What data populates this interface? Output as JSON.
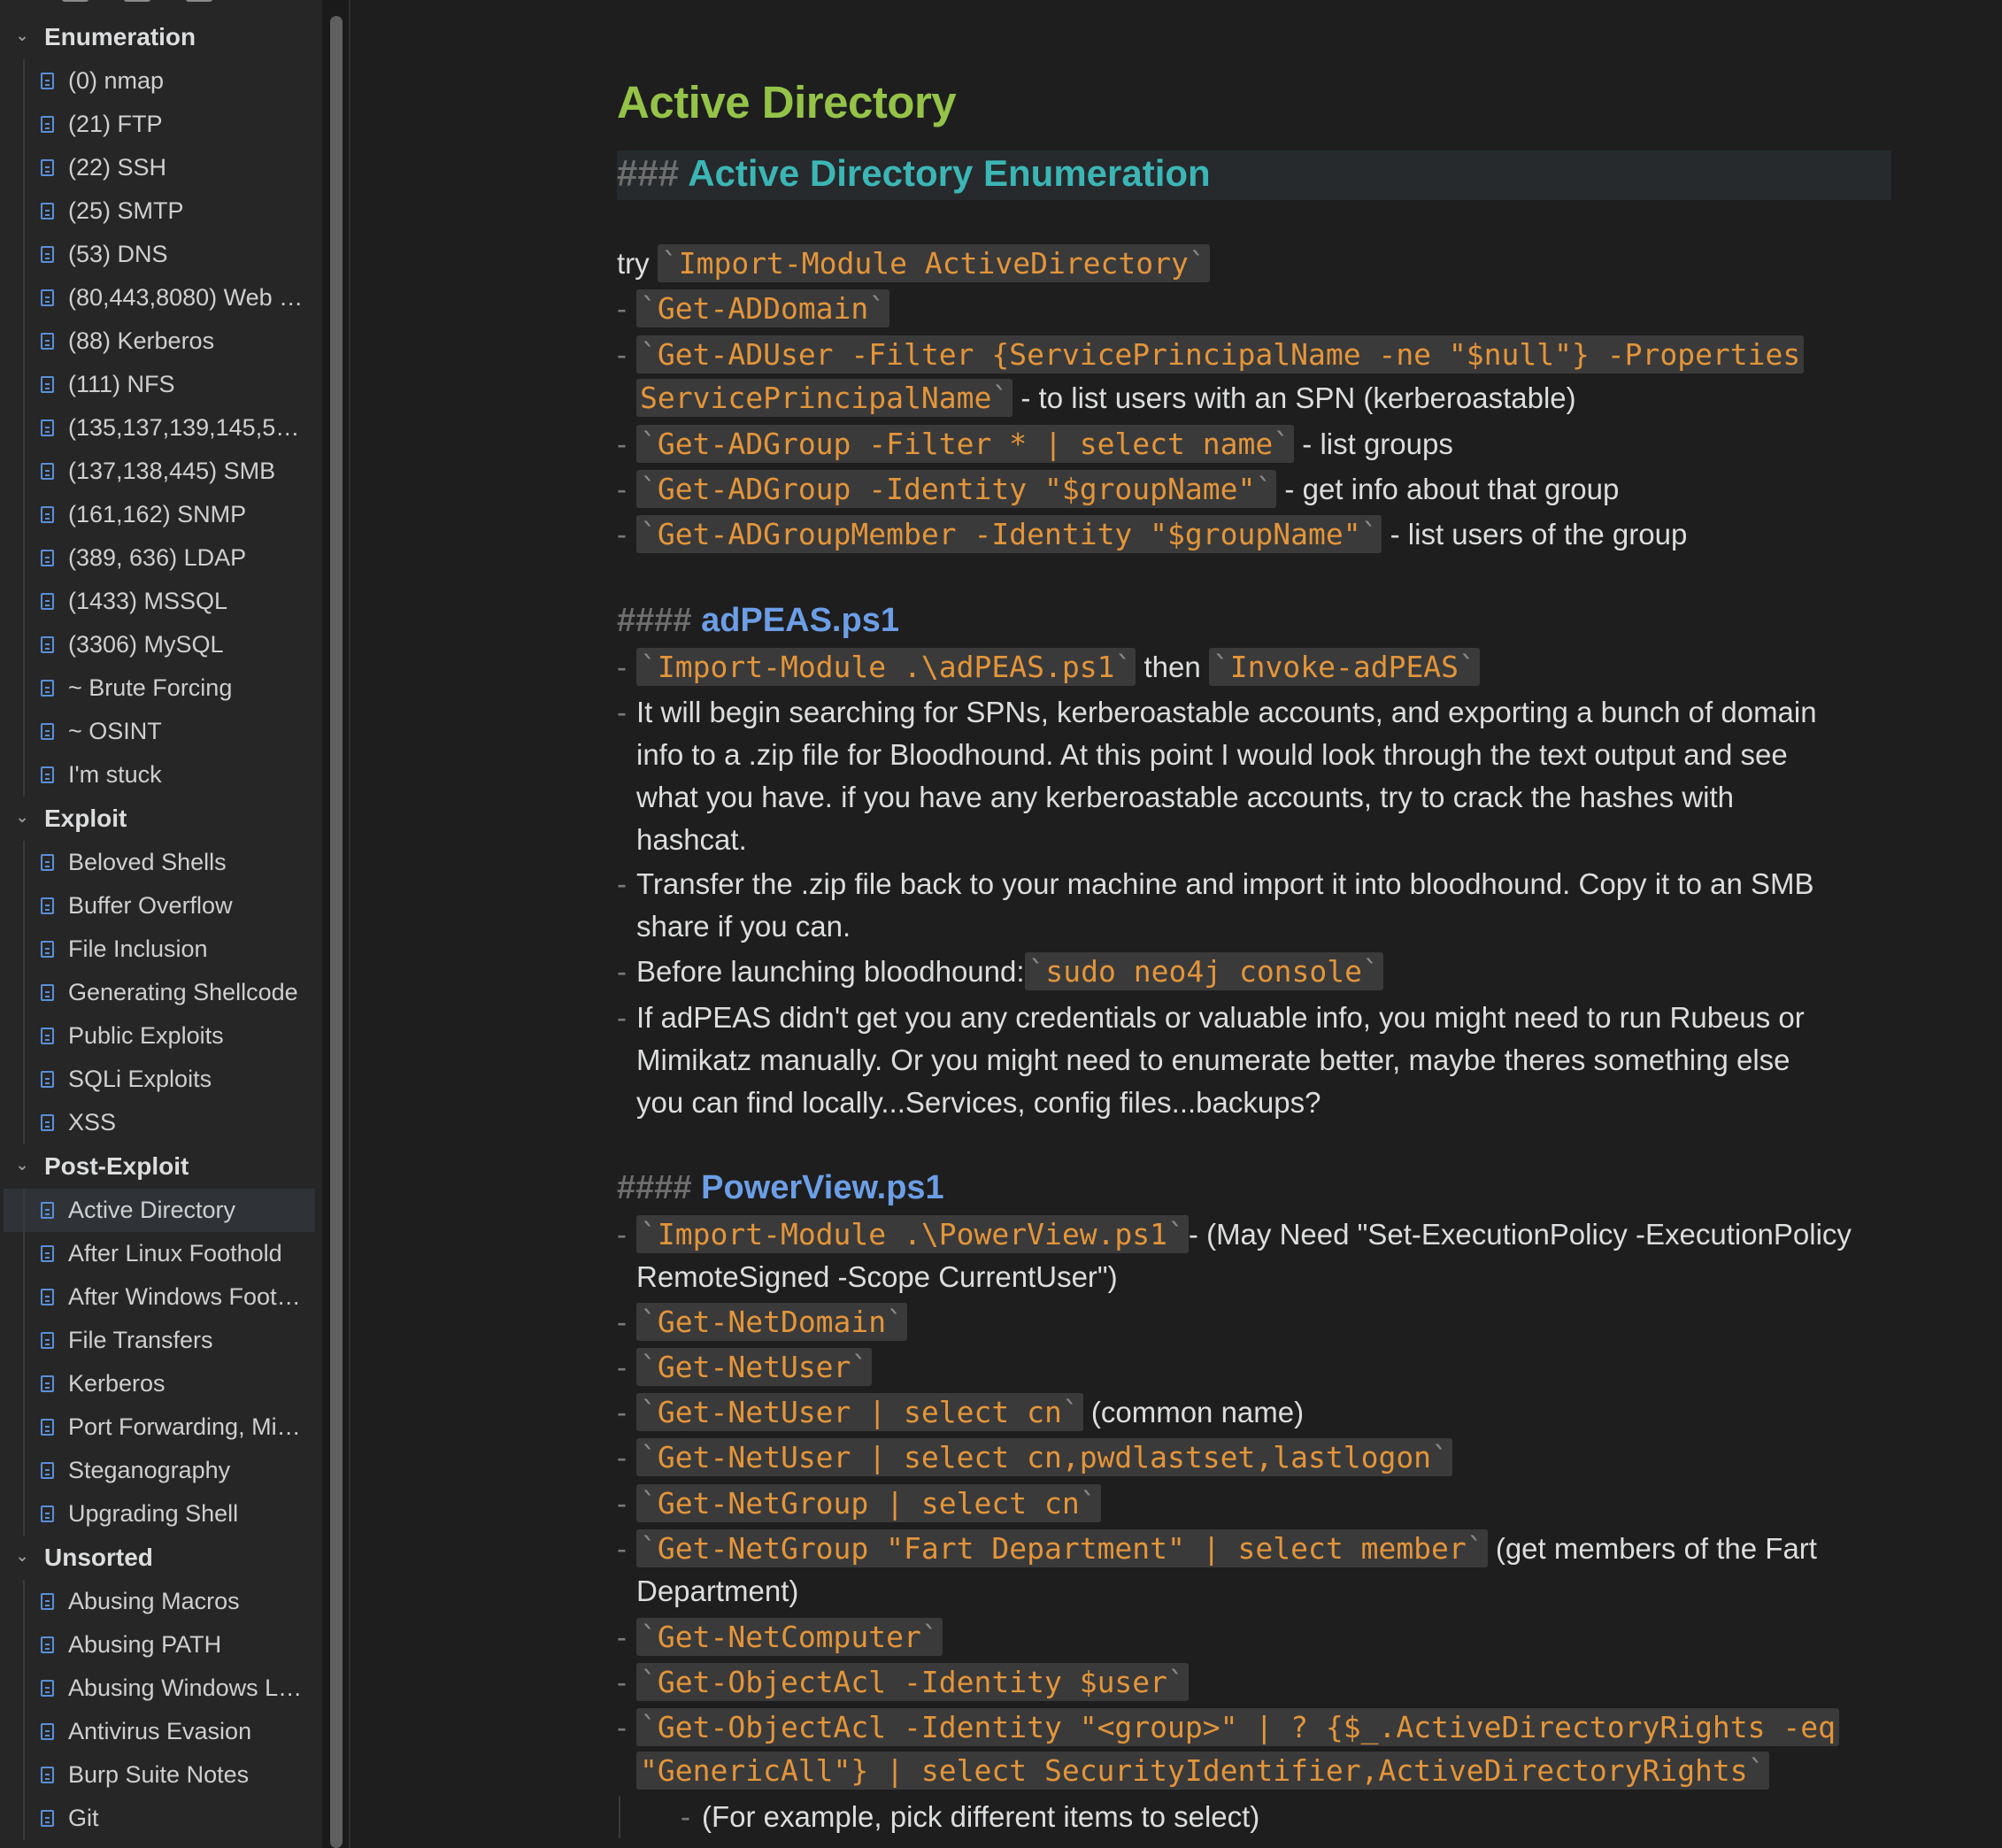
{
  "sidebar": {
    "folders": [
      {
        "label": "Enumeration",
        "items": [
          "(0) nmap",
          "(21) FTP",
          "(22) SSH",
          "(25) SMTP",
          "(53) DNS",
          "(80,443,8080) Web …",
          "(88) Kerberos",
          "(111) NFS",
          "(135,137,139,145,5…",
          "(137,138,445) SMB",
          "(161,162) SNMP",
          "(389, 636) LDAP",
          "(1433) MSSQL",
          "(3306) MySQL",
          "~ Brute Forcing",
          "~ OSINT",
          "I'm stuck"
        ]
      },
      {
        "label": "Exploit",
        "items": [
          "Beloved Shells",
          "Buffer Overflow",
          "File Inclusion",
          "Generating Shellcode",
          "Public Exploits",
          "SQLi Exploits",
          "XSS"
        ]
      },
      {
        "label": "Post-Exploit",
        "items": [
          "Active Directory",
          "After Linux Foothold",
          "After Windows Foot…",
          "File Transfers",
          "Kerberos",
          "Port Forwarding, Mi…",
          "Steganography",
          "Upgrading Shell"
        ]
      },
      {
        "label": "Unsorted",
        "items": [
          "Abusing Macros",
          "Abusing PATH",
          "Abusing Windows L…",
          "Antivirus Evasion",
          "Burp Suite Notes",
          "Git"
        ]
      }
    ],
    "active_item": "Active Directory"
  },
  "doc": {
    "title": "Active Directory",
    "h3_marker": "###",
    "h3": "Active Directory Enumeration",
    "try_text": "try",
    "import_ad": "Import-Module ActiveDirectory",
    "get_addomain": "Get-ADDomain",
    "get_aduser_1": "Get-ADUser -Filter {ServicePrincipalName -ne \"$null\"} -Properties",
    "get_aduser_2": "ServicePrincipalName",
    "get_aduser_desc": " - to list users with an SPN (kerberoastable)",
    "get_adgroup_filter": "Get-ADGroup -Filter * | select name",
    "get_adgroup_filter_desc": " - list groups",
    "get_adgroup_identity": "Get-ADGroup -Identity \"$groupName\"",
    "get_adgroup_identity_desc": " - get info about that group",
    "get_adgroupmember": "Get-ADGroupMember -Identity \"$groupName\"",
    "get_adgroupmember_desc": " - list users of the group",
    "h4_marker": "####",
    "h4_adpeas": "adPEAS.ps1",
    "import_adpeas": "Import-Module .\\adPEAS.ps1",
    "then_text": " then ",
    "invoke_adpeas": "Invoke-adPEAS",
    "adpeas_p1_l1": "It will begin searching for SPNs, kerberoastable accounts, and exporting a bunch of domain",
    "adpeas_p1_l2": "info to a .zip file for Bloodhound.  At this point I would look through the text output and see",
    "adpeas_p1_l3": "what you have.  if you have any kerberoastable accounts, try to crack the hashes with",
    "adpeas_p1_l4": "hashcat.",
    "adpeas_p2_l1": "Transfer the .zip file back to your machine and import it into bloodhound.  Copy it to an SMB",
    "adpeas_p2_l2": "share if you can.",
    "adpeas_p3": "Before launching bloodhound:",
    "neo4j": "sudo neo4j console",
    "adpeas_p4_l1": "If adPEAS didn't get you any credentials or valuable info, you might need to run Rubeus or",
    "adpeas_p4_l2": "Mimikatz manually.  Or you might need to enumerate better, maybe theres something else",
    "adpeas_p4_l3": "you can find locally...Services, config files...backups?",
    "h4_powerview": "PowerView.ps1",
    "import_powerview": "Import-Module .\\PowerView.ps1",
    "powerview_desc_1": "- (May Need \"Set-ExecutionPolicy -ExecutionPolicy",
    "powerview_desc_2": "RemoteSigned -Scope CurrentUser\")",
    "get_netdomain": "Get-NetDomain",
    "get_netuser": "Get-NetUser",
    "get_netuser_cn": "Get-NetUser | select cn",
    "get_netuser_cn_desc": " (common name)",
    "get_netuser_multi": "Get-NetUser | select cn,pwdlastset,lastlogon",
    "get_netgroup_cn": "Get-NetGroup | select cn",
    "get_netgroup_fart": "Get-NetGroup \"Fart Department\" | select member",
    "get_netgroup_fart_desc_1": " (get members of the Fart",
    "get_netgroup_fart_desc_2": "Department)",
    "get_netcomputer": "Get-NetComputer",
    "get_objectacl_user": "Get-ObjectAcl -Identity $user",
    "get_objectacl_group_1": "Get-ObjectAcl -Identity \"<group>\" | ? {$_.ActiveDirectoryRights -eq",
    "get_objectacl_group_2": "\"GenericAll\"} | select SecurityIdentifier,ActiveDirectoryRights",
    "example_note": "(For example, pick different items to select)"
  },
  "colors": {
    "background": "#1e1e1e",
    "sidebar": "#262626",
    "h1": "#94c348",
    "h3": "#3cb5b5",
    "h4": "#6c9ee6",
    "code": "#e3953a",
    "file_icon": "#5a8fd8"
  },
  "icons": {
    "file": "file-text-icon",
    "folder_toggle": "chevron-down-icon"
  }
}
